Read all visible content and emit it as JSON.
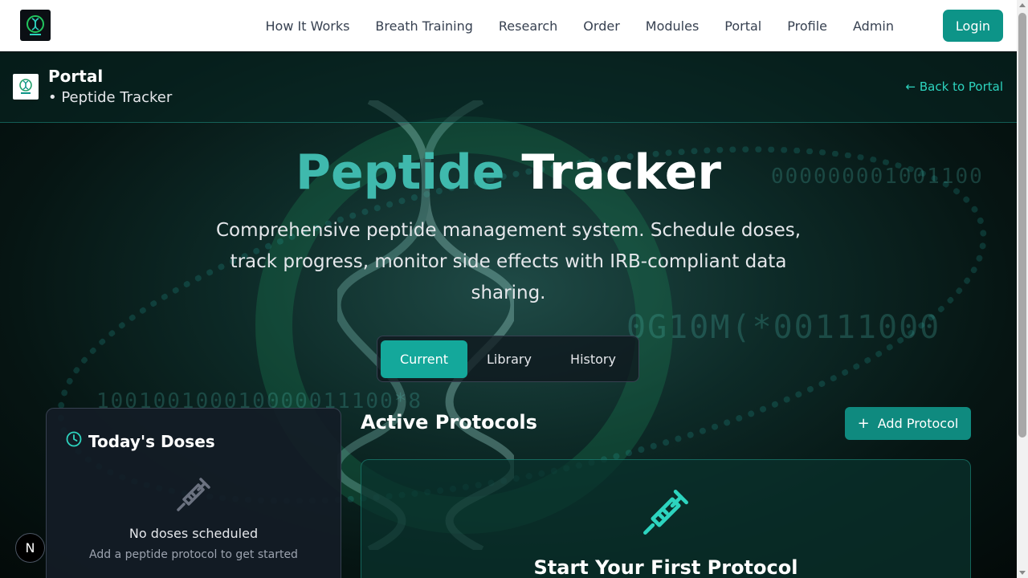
{
  "nav": {
    "links": [
      "How It Works",
      "Breath Training",
      "Research",
      "Order",
      "Modules",
      "Portal",
      "Profile",
      "Admin"
    ],
    "login_label": "Login"
  },
  "subheader": {
    "title": "Portal",
    "subtitle": "• Peptide Tracker",
    "back_label": "← Back to Portal"
  },
  "hero": {
    "title_accent": "Peptide",
    "title_rest": "Tracker",
    "description": "Comprehensive peptide management system. Schedule doses, track progress, monitor side effects with IRB-compliant data sharing."
  },
  "tabs": [
    {
      "label": "Current",
      "active": true
    },
    {
      "label": "Library",
      "active": false
    },
    {
      "label": "History",
      "active": false
    }
  ],
  "doses_card": {
    "title": "Today's Doses",
    "empty_title": "No doses scheduled",
    "empty_subtitle": "Add a peptide protocol to get started"
  },
  "protocols": {
    "title": "Active Protocols",
    "add_label": "Add Protocol",
    "empty_title": "Start Your First Protocol"
  },
  "badge": {
    "letter": "N"
  },
  "colors": {
    "accent": "#0d9488",
    "accent_light": "#3fb9ad",
    "link": "#2dd4bf"
  }
}
